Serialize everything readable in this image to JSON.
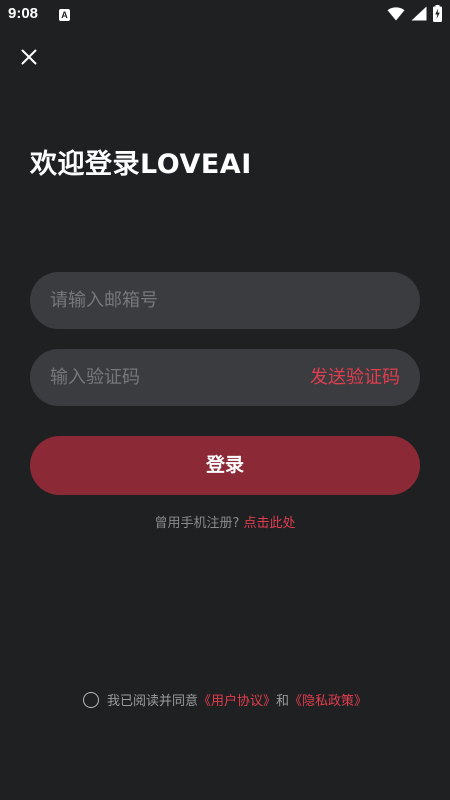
{
  "status_bar": {
    "time": "9:08",
    "a_icon_letter": "A",
    "icons": [
      "notification-a-icon",
      "wifi-icon",
      "signal-icon",
      "battery-charging-icon"
    ]
  },
  "header": {
    "close_icon": "close-icon",
    "title": "欢迎登录LOVEAI"
  },
  "form": {
    "email_placeholder": "请输入邮箱号",
    "code_placeholder": "输入验证码",
    "send_code_label": "发送验证码",
    "login_label": "登录"
  },
  "register": {
    "prompt": "曾用手机注册?",
    "link": "点击此处"
  },
  "agreement": {
    "prefix": "我已阅读并同意",
    "user_agreement": "《用户协议》",
    "conjunction": "和",
    "privacy_policy": "《隐私政策》",
    "checked": false
  },
  "colors": {
    "background": "#1f2022",
    "field_background": "#3b3c40",
    "accent": "#e23d4f",
    "login_button": "#8b2a36"
  }
}
